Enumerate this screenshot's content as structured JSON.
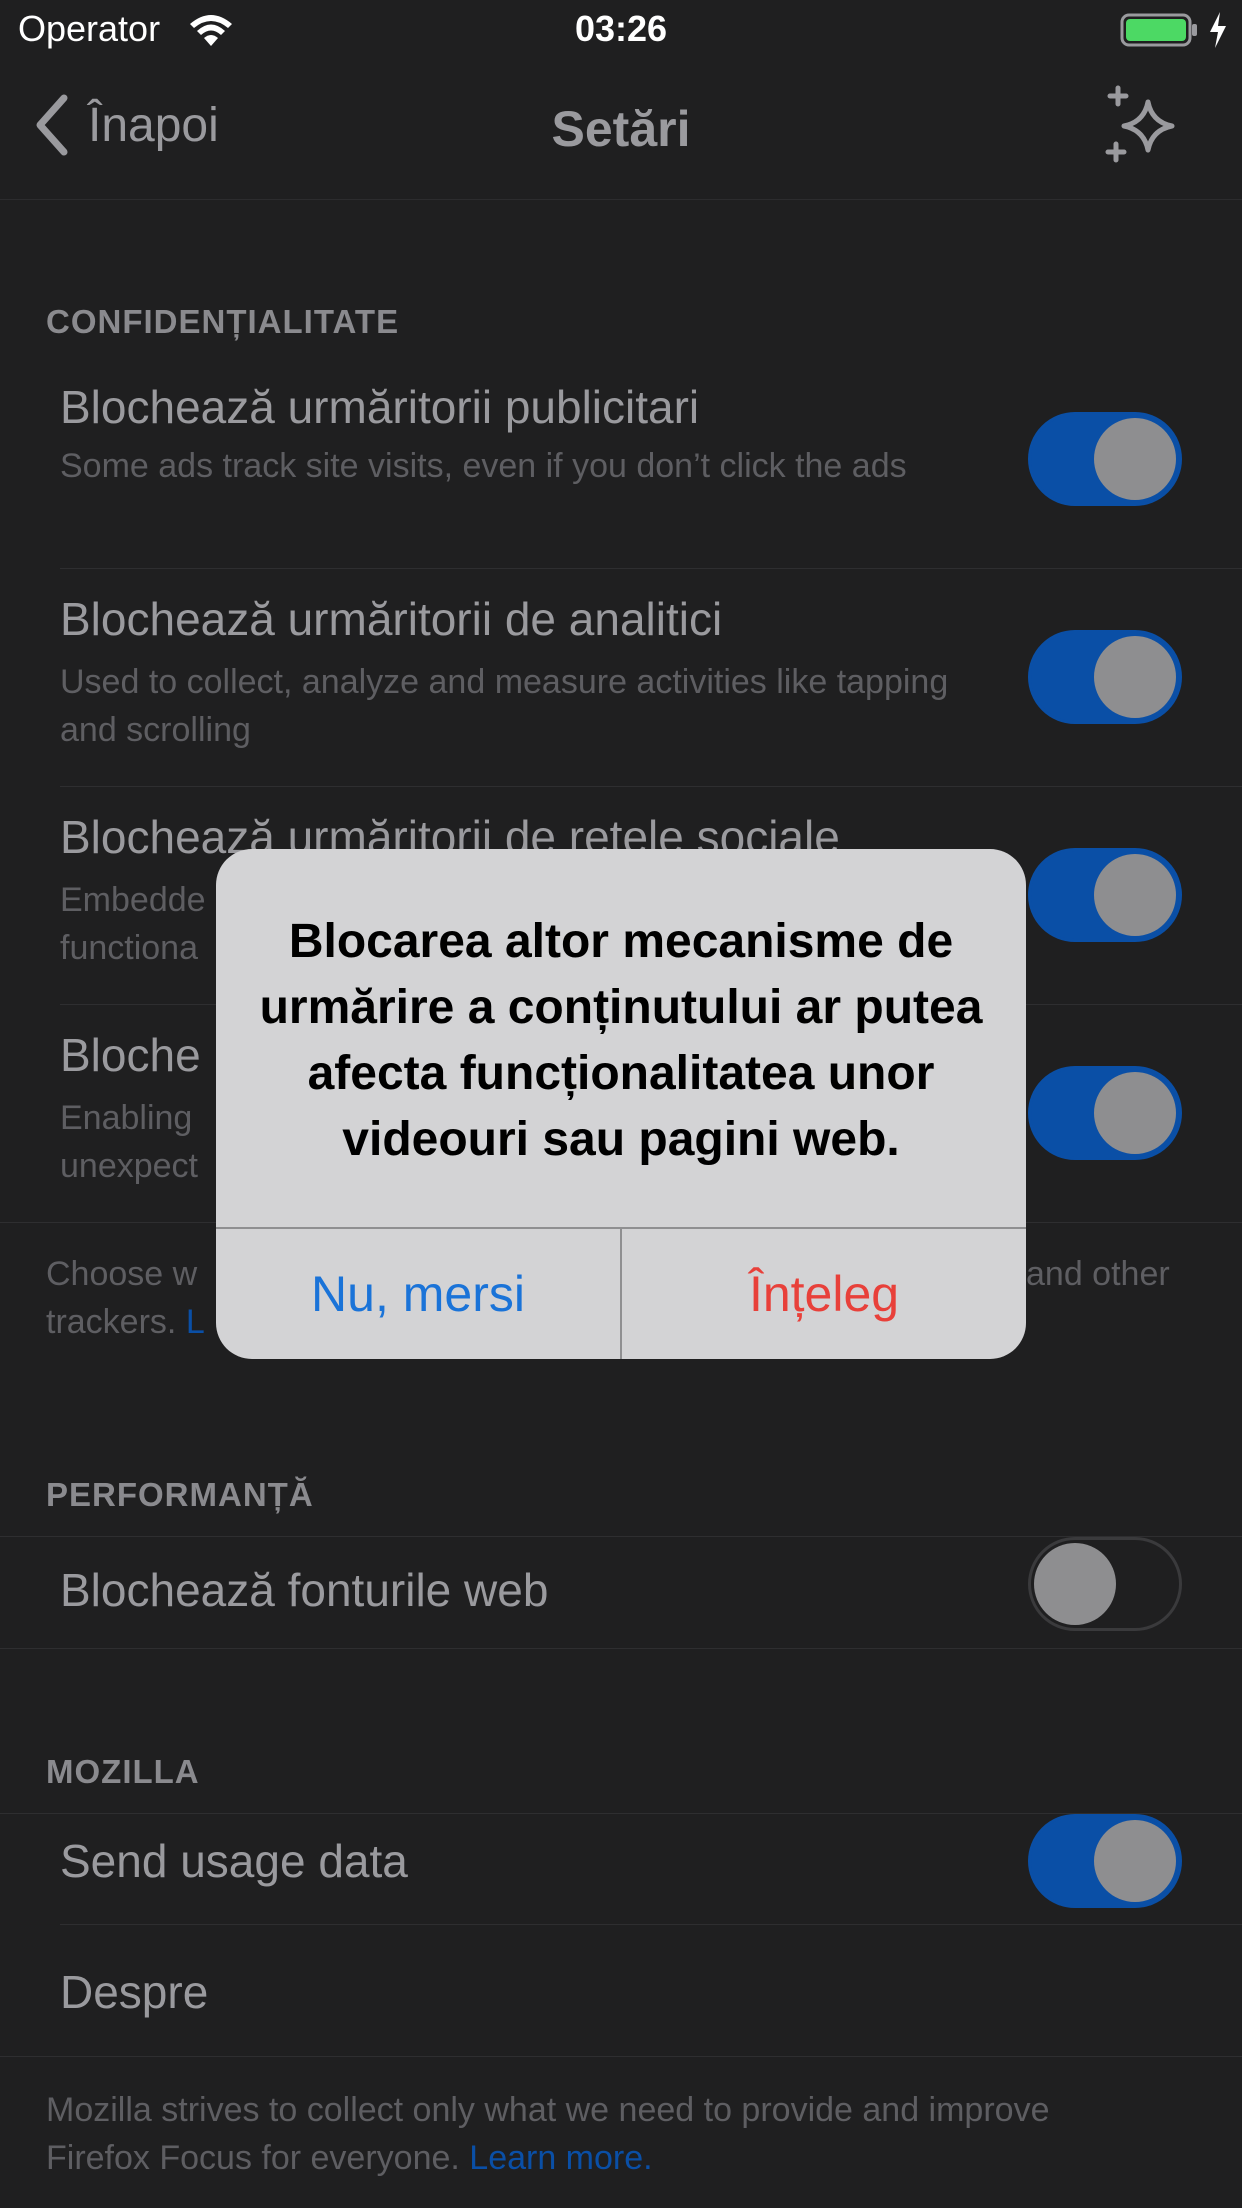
{
  "status_bar": {
    "carrier": "Operator",
    "time": "03:26",
    "battery_color": "#4cd964"
  },
  "nav": {
    "back_label": "Înapoi",
    "title": "Setări",
    "right_icon": "sparkle-icon"
  },
  "privacy": {
    "header": "CONFIDENȚIALITATE",
    "rows": [
      {
        "title": "Blochează urmăritorii publicitari",
        "subtitle": "Some ads track site visits, even if you don’t click the ads",
        "enabled": true
      },
      {
        "title": "Blochează urmăritorii de analitici",
        "subtitle": "Used to collect, analyze and measure activities like tapping and scrolling",
        "enabled": true
      },
      {
        "title": "Blochează urmăritorii de rețele sociale",
        "subtitle": "Embedde",
        "subtitle2": "functiona",
        "enabled": true
      },
      {
        "title": "Bloche",
        "subtitle": "Enabling",
        "subtitle2": "unexpect",
        "enabled": true
      }
    ],
    "footer_left": "Choose w",
    "footer_right": "and other",
    "footer_line2": "trackers.",
    "footer_link": "L"
  },
  "performance": {
    "header": "PERFORMANȚĂ",
    "rows": [
      {
        "title": "Blochează fonturile web",
        "enabled": false
      }
    ]
  },
  "mozilla": {
    "header": "MOZILLA",
    "rows": [
      {
        "title": "Send usage data",
        "enabled": true
      },
      {
        "title": "Despre"
      }
    ],
    "footer_line1": "Mozilla strives to collect only what we need to provide and improve",
    "footer_line2": "Firefox Focus for everyone.",
    "footer_link": "Learn more."
  },
  "alert": {
    "message": "Blocarea altor mecanisme de urmărire a conținutului ar putea afecta funcționalitatea unor videouri sau pagini web.",
    "cancel_label": "Nu, mersi",
    "confirm_label": "Înțeleg"
  },
  "colors": {
    "accent": "#0a4fa6",
    "alert_cancel": "#1a73d8",
    "alert_confirm": "#e8403a",
    "background": "#1f1f20"
  }
}
